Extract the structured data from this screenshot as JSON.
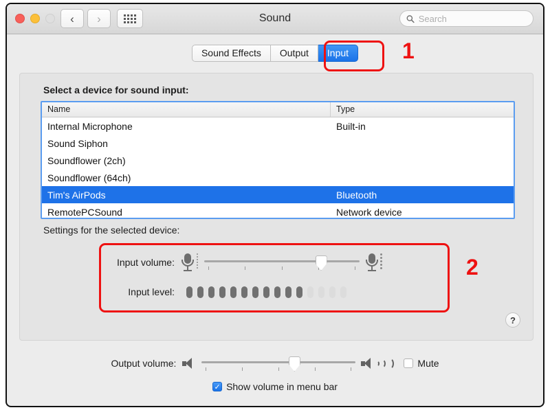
{
  "window": {
    "title": "Sound",
    "traffic_lights": [
      "close",
      "minimize",
      "zoom"
    ],
    "nav_back": "‹",
    "nav_forward": "›",
    "grid_button": "show-all-preferences"
  },
  "search": {
    "placeholder": "Search",
    "value": "",
    "icon": "search-icon"
  },
  "tabs": [
    {
      "label": "Sound Effects",
      "active": false
    },
    {
      "label": "Output",
      "active": false
    },
    {
      "label": "Input",
      "active": true
    }
  ],
  "input_pane": {
    "device_list_label": "Select a device for sound input:",
    "columns": [
      "Name",
      "Type"
    ],
    "rows": [
      {
        "name": "Internal Microphone",
        "type": "Built-in",
        "selected": false
      },
      {
        "name": "Sound Siphon",
        "type": "",
        "selected": false
      },
      {
        "name": "Soundflower (2ch)",
        "type": "",
        "selected": false
      },
      {
        "name": "Soundflower (64ch)",
        "type": "",
        "selected": false
      },
      {
        "name": "Tim's AirPods",
        "type": "Bluetooth",
        "selected": true
      },
      {
        "name": "RemotePCSound",
        "type": "Network device",
        "selected": false
      }
    ],
    "settings_label": "Settings for the selected device:",
    "input_volume_label": "Input volume:",
    "input_volume_percent": 75,
    "input_level_label": "Input level:",
    "input_level_segments_total": 15,
    "input_level_segments_active": 11,
    "help_label": "?"
  },
  "output_controls": {
    "output_volume_label": "Output volume:",
    "output_volume_percent": 60,
    "mute_label": "Mute",
    "mute_checked": false,
    "show_volume_label": "Show volume in menu bar",
    "show_volume_checked": true,
    "checkmark": "✓"
  },
  "annotations": [
    {
      "number": "1",
      "target": "input-tab"
    },
    {
      "number": "2",
      "target": "input-settings-area"
    }
  ],
  "colors": {
    "accent_blue": "#1e72e8",
    "annotation_red": "#ee1111",
    "window_bg": "#ececec",
    "panel_bg": "#e4e4e4"
  }
}
